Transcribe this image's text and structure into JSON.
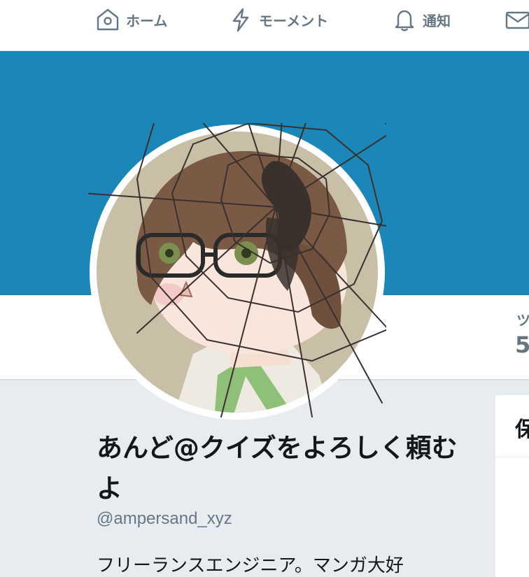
{
  "nav": {
    "home": "ホーム",
    "moments": "モーメント",
    "notifications": "通知"
  },
  "profile": {
    "display_name": "あんど@クイズをよろしく頼むよ",
    "screen_name": "@ampersand_xyz",
    "bio": "フリーランスエンジニア。マンガ大好"
  },
  "stats": {
    "label": "ツ",
    "value": "5"
  },
  "side_card": {
    "title": "保"
  },
  "colors": {
    "banner": "#1b86b8",
    "page_background": "#e6ecf0",
    "nav_text": "#657786"
  },
  "icons": [
    "home-icon",
    "moments-icon",
    "notifications-icon",
    "messages-icon"
  ]
}
